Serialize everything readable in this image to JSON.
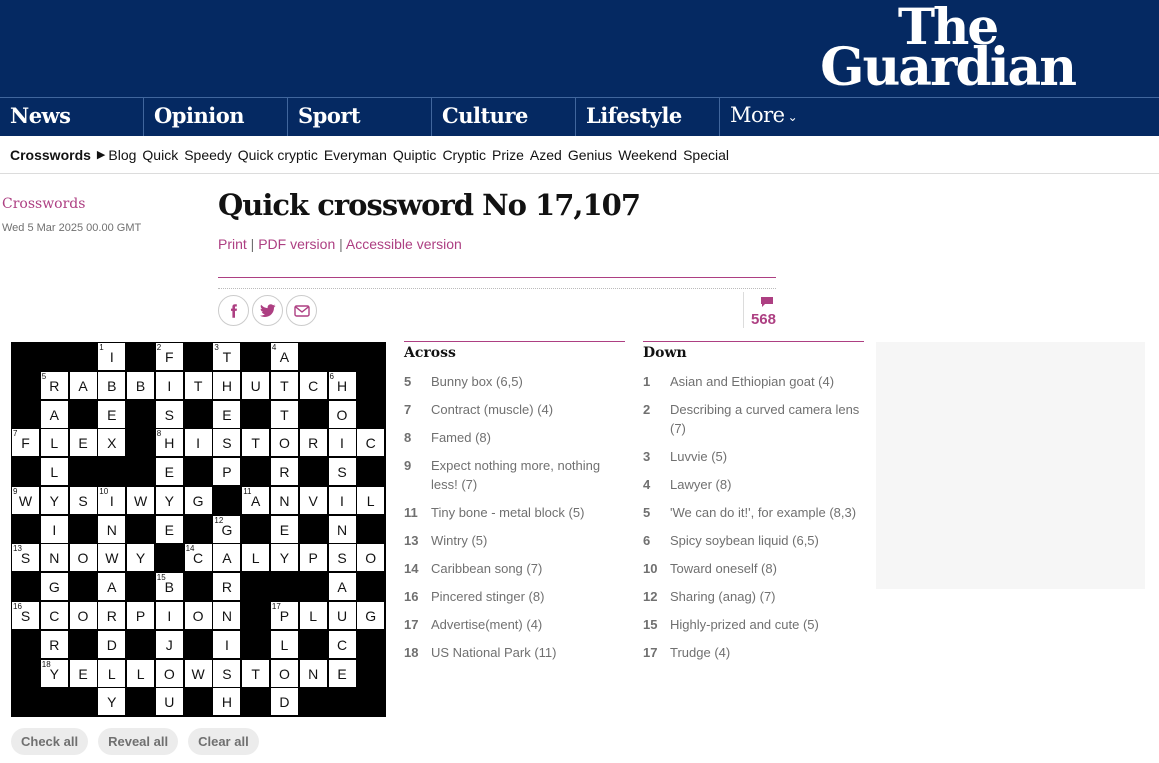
{
  "brand": {
    "line1": "The",
    "line2": "Guardian",
    "bg": "#052962",
    "accent": "#ad3f82"
  },
  "pillars": [
    "News",
    "Opinion",
    "Sport",
    "Culture",
    "Lifestyle"
  ],
  "more_label": "More",
  "subnav": {
    "root": "Crosswords",
    "items": [
      "Blog",
      "Quick",
      "Speedy",
      "Quick cryptic",
      "Everyman",
      "Quiptic",
      "Cryptic",
      "Prize",
      "Azed",
      "Genius",
      "Weekend",
      "Special"
    ]
  },
  "article": {
    "section": "Crosswords",
    "date": "Wed 5 Mar 2025 00.00 GMT",
    "title": "Quick crossword No 17,107",
    "links": [
      "Print",
      "PDF version",
      "Accessible version"
    ],
    "comment_count": "568"
  },
  "grid": {
    "rows": [
      "###I#F#T#A###",
      "#RABBITHUTCH#",
      "#A#E#S#E#T#O#",
      "FLEX#HISTORIC",
      "#L###E#P#R#S#",
      "WYSIWYG#ANVIL",
      "#I#N#E#G#E#N#",
      "SNOWY#CALYPSO",
      "#G#A#B#R###A#",
      "SCORPION#PLUG",
      "#R#D#J#I#L#C#",
      "#YELLOWSTONE#",
      "###Y#U#H#D###"
    ],
    "numbers": [
      {
        "r": 0,
        "c": 3,
        "n": "1"
      },
      {
        "r": 0,
        "c": 5,
        "n": "2"
      },
      {
        "r": 0,
        "c": 7,
        "n": "3"
      },
      {
        "r": 0,
        "c": 9,
        "n": "4"
      },
      {
        "r": 1,
        "c": 1,
        "n": "5"
      },
      {
        "r": 1,
        "c": 11,
        "n": "6"
      },
      {
        "r": 3,
        "c": 0,
        "n": "7"
      },
      {
        "r": 3,
        "c": 5,
        "n": "8"
      },
      {
        "r": 5,
        "c": 0,
        "n": "9"
      },
      {
        "r": 5,
        "c": 3,
        "n": "10"
      },
      {
        "r": 5,
        "c": 8,
        "n": "11"
      },
      {
        "r": 6,
        "c": 7,
        "n": "12"
      },
      {
        "r": 7,
        "c": 0,
        "n": "13"
      },
      {
        "r": 7,
        "c": 6,
        "n": "14"
      },
      {
        "r": 8,
        "c": 5,
        "n": "15"
      },
      {
        "r": 9,
        "c": 0,
        "n": "16"
      },
      {
        "r": 9,
        "c": 9,
        "n": "17"
      },
      {
        "r": 11,
        "c": 1,
        "n": "18"
      }
    ]
  },
  "across": {
    "heading": "Across",
    "clues": [
      {
        "num": "5",
        "text": "Bunny box (6,5)"
      },
      {
        "num": "7",
        "text": "Contract (muscle) (4)"
      },
      {
        "num": "8",
        "text": "Famed (8)"
      },
      {
        "num": "9",
        "text": "Expect nothing more, nothing less! (7)"
      },
      {
        "num": "11",
        "text": "Tiny bone - metal block (5)"
      },
      {
        "num": "13",
        "text": "Wintry (5)"
      },
      {
        "num": "14",
        "text": "Caribbean song (7)"
      },
      {
        "num": "16",
        "text": "Pincered stinger (8)"
      },
      {
        "num": "17",
        "text": "Advertise(ment) (4)"
      },
      {
        "num": "18",
        "text": "US National Park (11)"
      }
    ]
  },
  "down": {
    "heading": "Down",
    "clues": [
      {
        "num": "1",
        "text": "Asian and Ethiopian goat (4)"
      },
      {
        "num": "2",
        "text": "Describing a curved camera lens (7)"
      },
      {
        "num": "3",
        "text": "Luvvie (5)"
      },
      {
        "num": "4",
        "text": "Lawyer (8)"
      },
      {
        "num": "5",
        "text": "'We can do it!', for example (8,3)"
      },
      {
        "num": "6",
        "text": "Spicy soybean liquid (6,5)"
      },
      {
        "num": "10",
        "text": "Toward oneself (8)"
      },
      {
        "num": "12",
        "text": "Sharing (anag) (7)"
      },
      {
        "num": "15",
        "text": "Highly-prized and cute (5)"
      },
      {
        "num": "17",
        "text": "Trudge (4)"
      }
    ]
  },
  "buttons": {
    "check": "Check all",
    "reveal": "Reveal all",
    "clear": "Clear all"
  }
}
